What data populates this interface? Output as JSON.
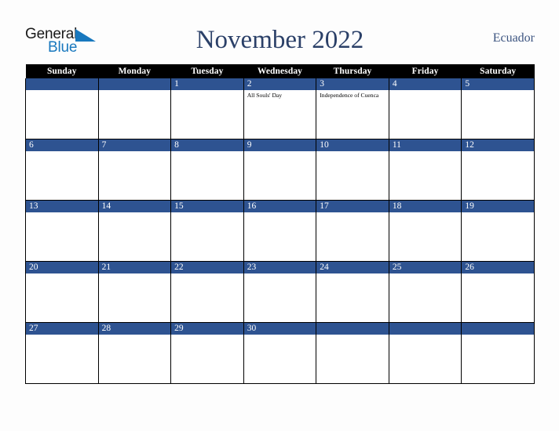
{
  "logo": {
    "word_one": "General",
    "word_two": "Blue",
    "triangle_icon": "blue-triangle-icon",
    "blue_color": "#1878be",
    "text_color": "#1a1a1a"
  },
  "header": {
    "title": "November 2022",
    "country": "Ecuador",
    "title_color": "#2b4068",
    "country_color": "#3c5480"
  },
  "calendar": {
    "weekday_headers": [
      "Sunday",
      "Monday",
      "Tuesday",
      "Wednesday",
      "Thursday",
      "Friday",
      "Saturday"
    ],
    "header_bg": "#000000",
    "header_text_color": "#ffffff",
    "daynum_bg": "#2e5391",
    "daynum_text_color": "#ffffff",
    "cell_bg": "#ffffff",
    "border_color": "#000000",
    "weeks": [
      [
        {
          "day": "",
          "events": []
        },
        {
          "day": "",
          "events": []
        },
        {
          "day": "1",
          "events": []
        },
        {
          "day": "2",
          "events": [
            "All Souls' Day"
          ]
        },
        {
          "day": "3",
          "events": [
            "Independence of Cuenca"
          ]
        },
        {
          "day": "4",
          "events": []
        },
        {
          "day": "5",
          "events": []
        }
      ],
      [
        {
          "day": "6",
          "events": []
        },
        {
          "day": "7",
          "events": []
        },
        {
          "day": "8",
          "events": []
        },
        {
          "day": "9",
          "events": []
        },
        {
          "day": "10",
          "events": []
        },
        {
          "day": "11",
          "events": []
        },
        {
          "day": "12",
          "events": []
        }
      ],
      [
        {
          "day": "13",
          "events": []
        },
        {
          "day": "14",
          "events": []
        },
        {
          "day": "15",
          "events": []
        },
        {
          "day": "16",
          "events": []
        },
        {
          "day": "17",
          "events": []
        },
        {
          "day": "18",
          "events": []
        },
        {
          "day": "19",
          "events": []
        }
      ],
      [
        {
          "day": "20",
          "events": []
        },
        {
          "day": "21",
          "events": []
        },
        {
          "day": "22",
          "events": []
        },
        {
          "day": "23",
          "events": []
        },
        {
          "day": "24",
          "events": []
        },
        {
          "day": "25",
          "events": []
        },
        {
          "day": "26",
          "events": []
        }
      ],
      [
        {
          "day": "27",
          "events": []
        },
        {
          "day": "28",
          "events": []
        },
        {
          "day": "29",
          "events": []
        },
        {
          "day": "30",
          "events": []
        },
        {
          "day": "",
          "events": []
        },
        {
          "day": "",
          "events": []
        },
        {
          "day": "",
          "events": []
        }
      ]
    ]
  }
}
